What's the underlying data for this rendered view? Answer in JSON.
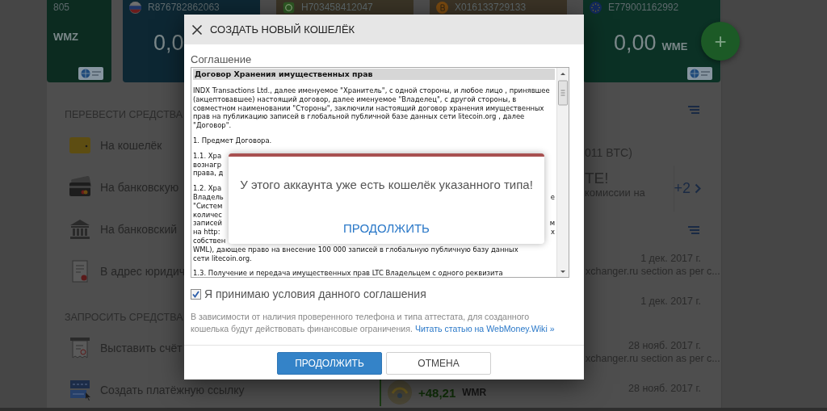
{
  "wallet_cards": [
    {
      "kind": "wmz",
      "number": "805",
      "currency": "WMZ"
    },
    {
      "kind": "wmr",
      "number": "R876782862063",
      "balance": "0,0"
    },
    {
      "kind": "wmh",
      "number": "H703458412047"
    },
    {
      "kind": "wmx",
      "number": "X016133729133"
    },
    {
      "kind": "wme",
      "number": "E779001162992",
      "balance": "0,00",
      "currency": "WME"
    }
  ],
  "add_button": {
    "label": "+"
  },
  "transfer_menu": {
    "title": "ПЕРЕВЕСТИ СРЕДСТВА",
    "items": [
      {
        "kind": "wallet",
        "label": "На кошелёк"
      },
      {
        "kind": "bank-card",
        "label": "На банковскую"
      },
      {
        "kind": "bank",
        "label": "На банковский"
      },
      {
        "kind": "company",
        "label": "В адрес юридич"
      }
    ]
  },
  "request_menu": {
    "title": "ЗАПРОСИТЬ СРЕДСТВА",
    "items": [
      {
        "kind": "invoice",
        "label": "Выставить счёт"
      },
      {
        "kind": "pay-link",
        "label": "Создать платёжную ссылку"
      }
    ]
  },
  "feed": {
    "balance_note": "011 BTC)",
    "promo": {
      "title": "ТЕ!",
      "text": "комиссии на",
      "more": "+2"
    },
    "events": [
      {
        "date": "1 дек. 2017 г.",
        "text": "xchanger.ru section as per c..."
      },
      {
        "date": "1 дек. 2017 г."
      },
      {
        "date": "28 нояб. 2017 г.",
        "text": "xchanger.ru section as per c..."
      },
      {
        "date": "28 нояб. 2017 г.",
        "amount": "+48,21",
        "currency": "WMR"
      }
    ]
  },
  "dialog": {
    "title": "СОЗДАТЬ НОВЫЙ КОШЕЛЁК",
    "agreement_label": "Соглашение",
    "document": {
      "heading": "Договор Хранения имущественных прав",
      "paragraphs": [
        {
          "kind": "text",
          "text": "INDX Transactions Ltd., далее именуемое \"Хранитель\", с одной стороны, и любое лицо , принявшее (акцептовавшее) настоящий договор, далее именуемое \"Владелец\", с другой стороны, в совместном наименовании \"Стороны\", заключили настоящий договор хранения имущественных прав на публикацию записей в глобальной публичной базе данных сети litecoin.org , далее \"Договор\"."
        },
        {
          "kind": "text",
          "text": "1. Предмет Договора."
        },
        {
          "kind": "fragments",
          "lines": [
            {
              "left": "1.1. Хра"
            },
            {
              "left": "вознагр"
            },
            {
              "left": "права, д"
            }
          ]
        },
        {
          "kind": "fragments",
          "lines": [
            {
              "left": "1.2. Хра"
            },
            {
              "left": "Владель",
              "right": "е"
            },
            {
              "left": "\"Систем"
            },
            {
              "left": "количес"
            },
            {
              "left": "записей",
              "right": "м"
            },
            {
              "left": "на http:",
              "right": "х"
            },
            {
              "left": "собствен"
            },
            {
              "left": "WML), дающее право на внесение 100 000 записей в глобальную публичную базу данных"
            },
            {
              "left": "сети litecoin.org."
            }
          ]
        },
        {
          "kind": "text",
          "text": "1.3. Получение и передача имущественных прав LTC Владельцем с одного реквизита"
        }
      ]
    },
    "accept": {
      "label": "Я принимаю условия данного соглашения",
      "checked": true
    },
    "note": "В зависимости от наличия проверенного телефона и типа аттестата, для созданного кошелька будут действовать финансовые ограничения.",
    "note_link": "Читать статью на WebMoney.Wiki »",
    "buttons": [
      {
        "kind": "primary",
        "label": "ПРОДОЛЖИТЬ"
      },
      {
        "kind": "secondary",
        "label": "ОТМЕНА"
      }
    ]
  },
  "alert": {
    "message": "У этого аккаунта уже есть кошелёк указанного типа!",
    "button": "ПРОДОЛЖИТЬ"
  }
}
